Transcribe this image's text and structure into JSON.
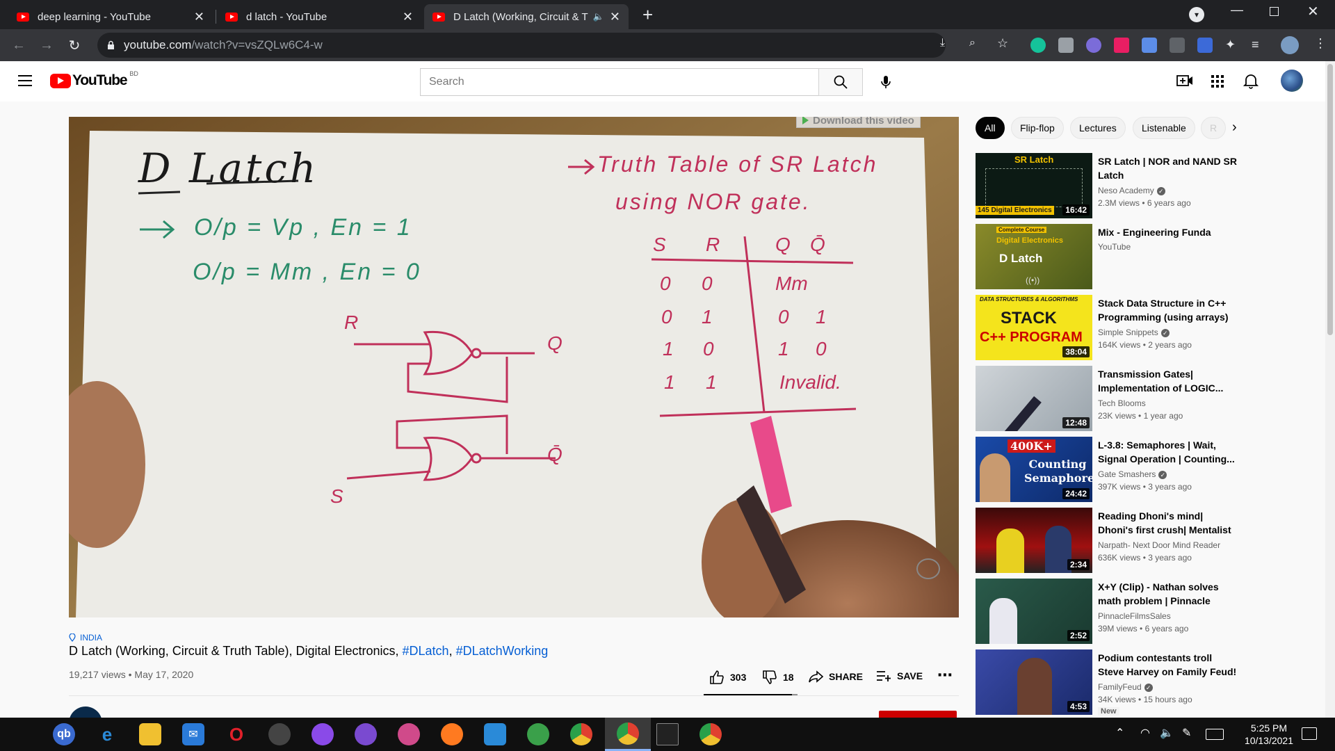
{
  "tabs": [
    {
      "title": "deep learning - YouTube"
    },
    {
      "title": "d latch - YouTube"
    },
    {
      "title": "D Latch (Working, Circuit & T"
    }
  ],
  "toolbar": {
    "url_host": "youtube.com",
    "url_path": "/watch?v=vsZQLw6C4-w"
  },
  "masthead": {
    "logo": "YouTube",
    "region": "BD",
    "search_placeholder": "Search"
  },
  "player": {
    "download_button": "Download this video",
    "whiteboard": {
      "title": "D Latch",
      "line1": "O/p = Vp , En = 1",
      "line2": "O/p = Mm , En = 0",
      "table_heading1": "Truth Table of SR Latch",
      "table_heading2": "using NOR gate.",
      "table_headers": [
        "S",
        "R",
        "Q",
        "Q̄"
      ],
      "table_rows": [
        [
          "0",
          "0",
          "Mm",
          ""
        ],
        [
          "0",
          "1",
          "0",
          "1"
        ],
        [
          "1",
          "0",
          "1",
          "0"
        ],
        [
          "1",
          "1",
          "Invalid.",
          ""
        ]
      ],
      "r_label": "R",
      "s_label": "S",
      "q_label": "Q",
      "qbar_label": "Q̄"
    }
  },
  "video": {
    "location": "INDIA",
    "title_main": "D Latch (Working, Circuit & Truth Table), Digital Electronics, ",
    "hashtag1": "#DLatch",
    "comma": ", ",
    "hashtag2": "#DLatchWorking",
    "views": "19,217 views",
    "date": "May 17, 2020",
    "likes": "303",
    "dislikes": "18",
    "share": "SHARE",
    "save": "SAVE"
  },
  "chips": [
    "All",
    "Flip-flop",
    "Lectures",
    "Listenable",
    "R"
  ],
  "recommendations": [
    {
      "title": "SR Latch | NOR and NAND SR Latch",
      "channel": "Neso Academy",
      "verified": true,
      "views": "2.3M views",
      "age": "6 years ago",
      "duration": "16:42",
      "thumb_title": "SR Latch",
      "thumb_tag": "145 Digital Electronics"
    },
    {
      "title": "Mix - Engineering Funda",
      "channel": "YouTube",
      "verified": false,
      "views": "",
      "age": "",
      "duration": "",
      "thumb_top": "Complete Course",
      "thumb_mid": "Digital Electronics",
      "thumb_title": "D Latch"
    },
    {
      "title": "Stack Data Structure in C++ Programming (using arrays) |...",
      "channel": "Simple Snippets",
      "verified": true,
      "views": "164K views",
      "age": "2 years ago",
      "duration": "38:04",
      "thumb_top": "DATA STRUCTURES & ALGORITHMS",
      "thumb_title": "STACK",
      "thumb_sub": "C++ PROGRAM"
    },
    {
      "title": "Transmission Gates| Implementation of LOGIC...",
      "channel": "Tech Blooms",
      "verified": false,
      "views": "23K views",
      "age": "1 year ago",
      "duration": "12:48"
    },
    {
      "title": "L-3.8: Semaphores | Wait, Signal Operation | Counting...",
      "channel": "Gate Smashers",
      "verified": true,
      "views": "397K views",
      "age": "3 years ago",
      "duration": "24:42",
      "thumb_badge": "400K+",
      "thumb_title": "Counting Semaphore"
    },
    {
      "title": "Reading Dhoni's mind| Dhoni's first crush| Mentalist Narpath",
      "channel": "Narpath- Next Door Mind Reader",
      "verified": false,
      "views": "636K views",
      "age": "3 years ago",
      "duration": "2:34"
    },
    {
      "title": "X+Y (Clip) - Nathan solves math problem | Pinnacle Films",
      "channel": "PinnacleFilmsSales",
      "verified": false,
      "views": "39M views",
      "age": "6 years ago",
      "duration": "2:52"
    },
    {
      "title": "Podium contestants troll Steve Harvey on Family Feud!",
      "channel": "FamilyFeud",
      "verified": true,
      "views": "34K views",
      "age": "15 hours ago",
      "duration": "4:53",
      "badge": "New"
    }
  ],
  "taskbar": {
    "time": "5:25 PM",
    "date": "10/13/2021"
  }
}
